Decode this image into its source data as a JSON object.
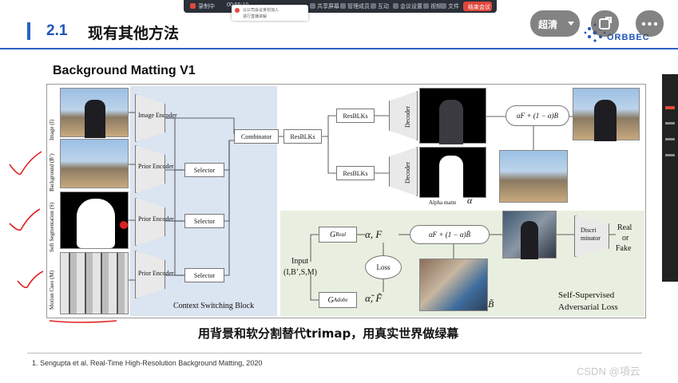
{
  "toolbar": {
    "recording_label": "录制中",
    "timer": "00:55:10",
    "items": [
      "共享屏幕",
      "管理成员",
      "互动",
      "会议设置",
      "视频",
      "文件"
    ],
    "end_button": "结束会议",
    "toast_line1": "以公司会议身份加入",
    "toast_line2": "进行直播讲解"
  },
  "slide": {
    "section_number": "2.1",
    "section_title": "现有其他方法",
    "paper_title": "Background Matting V1",
    "caption": "用背景和软分割替代trimap，用真实世界做绿幕",
    "reference": "1. Sengupta et al. Real-Time High-Resolution Background Matting, 2020",
    "logo": "ORBBEC"
  },
  "player": {
    "quality_label": "超清"
  },
  "figure": {
    "row_labels": [
      "Image (I)",
      "Background (B’)",
      "Soft Segmentation (S)",
      "Motion Cues (M)"
    ],
    "encoders": [
      "Image Encoder",
      "Prior Encoder",
      "Prior Encoder",
      "Prior Encoder"
    ],
    "selector": "Selector",
    "combinator": "Combinator",
    "resblks": "ResBLKs",
    "decoder": "Decoder",
    "alpha_matte": "Alpha matte",
    "alpha_symbol": "α",
    "composite_formula": "αF + (1 − α)B",
    "composite_formula_tilde": "αF + (1 − α)B̃",
    "context_block_label": "Context Switching Block",
    "g_real": "G",
    "g_real_sub": "Real",
    "g_adobe": "G",
    "g_adobe_sub": "Adobe",
    "out_real": "α, F",
    "out_adobe": "α̃, F̃",
    "input_label_line1": "Input",
    "input_label_line2": "(I,B’,S,M)",
    "loss": "Loss",
    "b_tilde": "B̃",
    "discriminator": "Discri minator",
    "real_or_fake_line1": "Real",
    "real_or_fake_line2": "or",
    "real_or_fake_line3": "Fake",
    "self_supervised_line1": "Self-Supervised",
    "self_supervised_line2": "Adversarial Loss"
  },
  "watermark": "CSDN @項云",
  "colors": {
    "accent_blue": "#1f56b8",
    "context_block": "#dbe4f1",
    "green_block": "#e9efe0",
    "annotation_red": "#e02020"
  }
}
